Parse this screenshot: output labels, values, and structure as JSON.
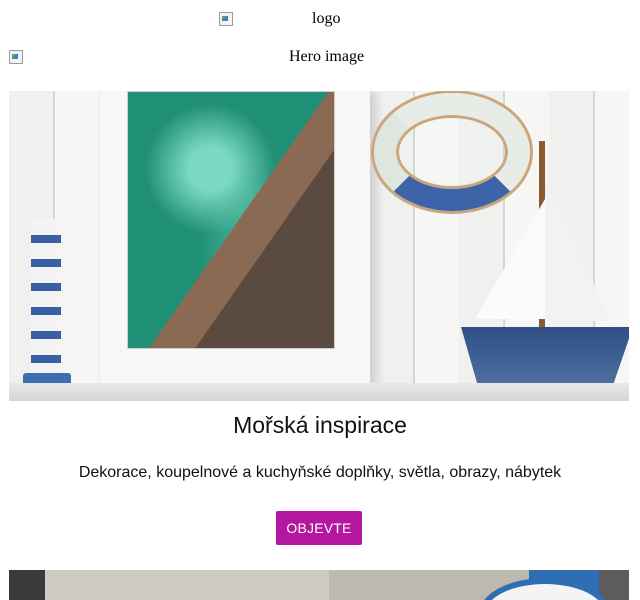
{
  "header": {
    "logo_alt": "logo",
    "hero_alt": "Hero image"
  },
  "main": {
    "title": "Mořská inspirace",
    "subtitle": "Dekorace, koupelnové a kuchyňské doplňky, světla, obrazy, nábytek",
    "cta_label": "OBJEVTE"
  },
  "colors": {
    "cta_background": "#b4169f",
    "cta_text": "#ffffff"
  }
}
